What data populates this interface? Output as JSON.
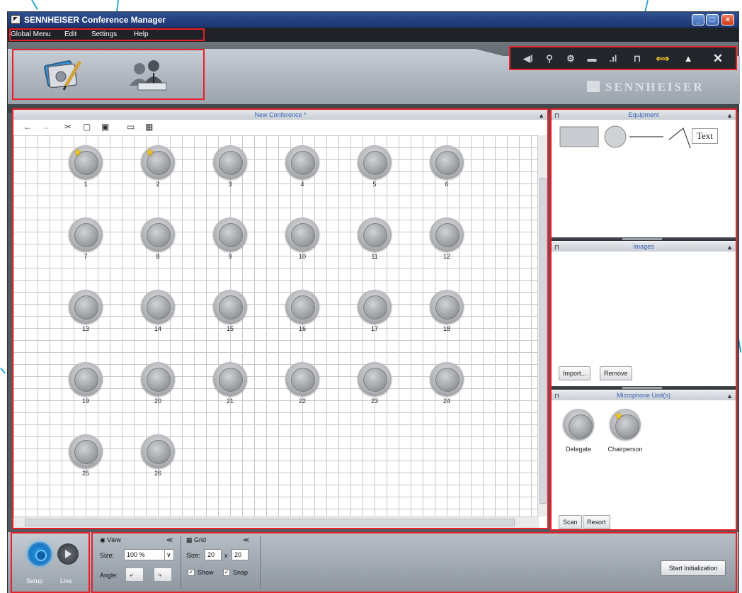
{
  "window": {
    "title": "SENNHEISER Conference Manager",
    "controls": [
      "minimize",
      "maximize",
      "close"
    ]
  },
  "menu": {
    "items": [
      "Global Menu",
      "Edit",
      "Settings",
      "Help"
    ]
  },
  "toolbar": {
    "modes": [
      {
        "name": "conference-design-icon"
      },
      {
        "name": "participants-icon"
      }
    ],
    "actions": [
      "volume-icon",
      "search-icon",
      "settings-icon",
      "battery-icon",
      "signal-icon",
      "lock-icon",
      "link-icon",
      "warning-icon",
      "close-icon"
    ],
    "brand": "SENNHEISER",
    "accent_color": "#e8202a"
  },
  "canvas": {
    "title": "New Conference *",
    "tools": [
      "←",
      "→",
      "✂",
      "▢",
      "▣",
      "▭",
      "▦"
    ],
    "microphones": [
      {
        "label": "1",
        "chair": true
      },
      {
        "label": "2",
        "chair": true
      },
      {
        "label": "3",
        "chair": false
      },
      {
        "label": "4",
        "chair": false
      },
      {
        "label": "5",
        "chair": false
      },
      {
        "label": "6",
        "chair": false
      },
      {
        "label": "7",
        "chair": false
      },
      {
        "label": "8",
        "chair": false
      },
      {
        "label": "9",
        "chair": false
      },
      {
        "label": "10",
        "chair": false
      },
      {
        "label": "11",
        "chair": false
      },
      {
        "label": "12",
        "chair": false
      },
      {
        "label": "13",
        "chair": false
      },
      {
        "label": "14",
        "chair": false
      },
      {
        "label": "15",
        "chair": false
      },
      {
        "label": "16",
        "chair": false
      },
      {
        "label": "17",
        "chair": false
      },
      {
        "label": "18",
        "chair": false
      },
      {
        "label": "19",
        "chair": false
      },
      {
        "label": "20",
        "chair": false
      },
      {
        "label": "21",
        "chair": false
      },
      {
        "label": "22",
        "chair": false
      },
      {
        "label": "23",
        "chair": false
      },
      {
        "label": "24",
        "chair": false
      },
      {
        "label": "25",
        "chair": false
      },
      {
        "label": "26",
        "chair": false
      }
    ]
  },
  "equipment": {
    "title": "Equipment",
    "text_tool": "Text"
  },
  "images": {
    "title": "Images",
    "import_label": "Import...",
    "remove_label": "Remove"
  },
  "microphone_units": {
    "title": "Microphone Unit(s)",
    "units": [
      {
        "label": "Delegate"
      },
      {
        "label": "Chairperson"
      }
    ],
    "scan_label": "Scan",
    "resort_label": "Resort"
  },
  "bottom": {
    "setup_label": "Setup",
    "live_label": "Live",
    "view": {
      "title": "View",
      "size_label": "Size:",
      "size_value": "100 %",
      "angle_label": "Angle:"
    },
    "grid": {
      "title": "Grid",
      "size_label": "Size:",
      "width": "20",
      "x": "x",
      "height": "20",
      "show_label": "Show",
      "snap_label": "Snap"
    },
    "start_label": "Start Initialization"
  }
}
